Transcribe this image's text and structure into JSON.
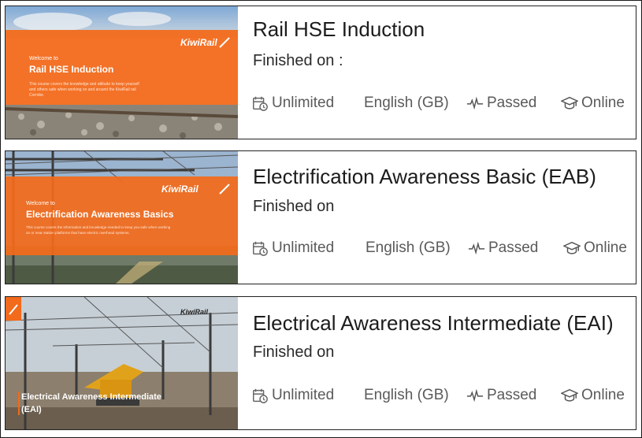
{
  "courses": [
    {
      "title": "Rail HSE Induction",
      "finished_label": "Finished on :",
      "attempts": "Unlimited",
      "language": "English (GB)",
      "status": "Passed",
      "delivery": "Online",
      "thumb": {
        "welcome": "Welcome to",
        "heading": "Rail HSE Induction",
        "brand": "KiwiRail",
        "desc_1": "This course covers the knowledge and attitude to keep yourself",
        "desc_2": "and others safe when working on and around the KiwiRail rail",
        "desc_3": "Corridor."
      }
    },
    {
      "title": "Electrification Awareness Basic (EAB)",
      "finished_label": "Finished on",
      "attempts": "Unlimited",
      "language": "English (GB)",
      "status": "Passed",
      "delivery": "Online",
      "thumb": {
        "welcome": "Welcome to",
        "heading": "Electrification Awareness Basics",
        "brand": "KiwiRail",
        "desc_1": "This course covers the information and knowledge needed to keep you safe when working",
        "desc_2": "on or near station platforms that have electric overhead systems."
      }
    },
    {
      "title": "Electrical Awareness Intermediate (EAI)",
      "finished_label": "Finished on",
      "attempts": "Unlimited",
      "language": "English (GB)",
      "status": "Passed",
      "delivery": "Online",
      "thumb": {
        "brand": "KiwiRail",
        "caption_1": "Electrical Awareness Intermediate",
        "caption_2": "(EAI)"
      }
    }
  ],
  "colors": {
    "orange": "#f26a1b",
    "text": "#1c1c1c",
    "meta": "#5a5a5a"
  },
  "icons": [
    "attempts-icon",
    "activity-icon",
    "graduation-cap-icon"
  ]
}
